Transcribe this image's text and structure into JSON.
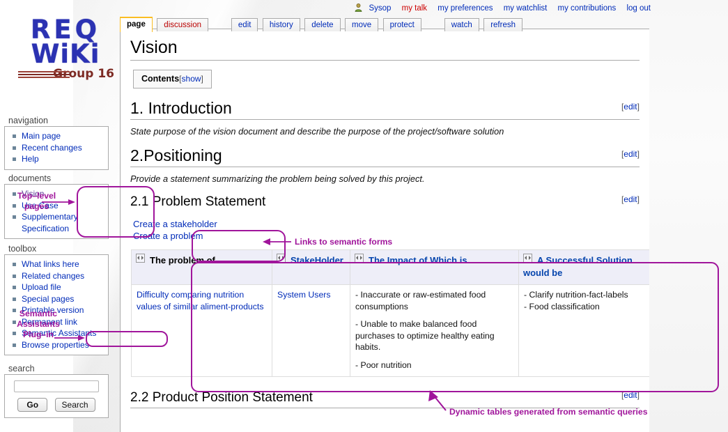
{
  "logo": {
    "line1": "REQ",
    "line2": "WiKi",
    "line3": "Group 16"
  },
  "personal": {
    "user": "Sysop",
    "links": [
      {
        "label": "my talk",
        "style": "new"
      },
      {
        "label": "my preferences",
        "style": "normal"
      },
      {
        "label": "my watchlist",
        "style": "normal"
      },
      {
        "label": "my contributions",
        "style": "normal"
      },
      {
        "label": "log out",
        "style": "normal"
      }
    ]
  },
  "tabs": [
    {
      "label": "page",
      "state": "selected"
    },
    {
      "label": "discussion",
      "state": "new"
    },
    {
      "label": "edit",
      "state": "normal"
    },
    {
      "label": "history",
      "state": "normal"
    },
    {
      "label": "delete",
      "state": "normal"
    },
    {
      "label": "move",
      "state": "normal"
    },
    {
      "label": "protect",
      "state": "normal"
    },
    {
      "label": "watch",
      "state": "normal"
    },
    {
      "label": "refresh",
      "state": "normal"
    }
  ],
  "sidebar": {
    "navigation": {
      "title": "navigation",
      "items": [
        {
          "label": "Main page",
          "visited": false
        },
        {
          "label": "Recent changes",
          "visited": false
        },
        {
          "label": "Help",
          "visited": false
        }
      ]
    },
    "documents": {
      "title": "documents",
      "items": [
        {
          "label": "Vision",
          "visited": true
        },
        {
          "label": "Use Case",
          "visited": false
        },
        {
          "label": "Supplementary",
          "visited": false,
          "cont": "Specification"
        }
      ]
    },
    "toolbox": {
      "title": "toolbox",
      "items": [
        {
          "label": "What links here"
        },
        {
          "label": "Related changes"
        },
        {
          "label": "Upload file"
        },
        {
          "label": "Special pages"
        },
        {
          "label": "Printable version"
        },
        {
          "label": "Permanent link"
        },
        {
          "label": "Semantic Assistants"
        },
        {
          "label": "Browse properties"
        }
      ]
    },
    "search": {
      "title": "search",
      "value": "",
      "placeholder": "",
      "go_label": "Go",
      "search_label": "Search"
    }
  },
  "page": {
    "title": "Vision",
    "toc": {
      "label": "Contents",
      "open_bracket": "[",
      "toggle": "show",
      "close_bracket": "]"
    },
    "sections": [
      {
        "heading": "1. Introduction",
        "edit": "edit",
        "lead": "State purpose of the vision document and describe the purpose of the project/software solution"
      },
      {
        "heading": "2.Positioning",
        "edit": "edit",
        "lead": "Provide a statement summarizing the problem being solved by this project."
      }
    ],
    "subsection_1": {
      "heading": "2.1 Problem Statement",
      "edit": "edit"
    },
    "subsection_2": {
      "heading": "2.2 Product Position Statement",
      "edit": "edit"
    },
    "form_links": [
      {
        "label": "Create a stakeholder"
      },
      {
        "label": "Create a problem"
      }
    ],
    "table": {
      "headers": [
        {
          "label": "The problem of",
          "color": "black"
        },
        {
          "label": "StakeHolder",
          "color": "blue"
        },
        {
          "label": "The Impact of Which is",
          "color": "blue"
        },
        {
          "label": "A Successful Solution would be",
          "color": "blue"
        }
      ],
      "rows": [
        {
          "problem": "Difficulty comparing nutrition values of similar aliment-products",
          "stakeholder": "System Users",
          "impacts": [
            "- Inaccurate or raw-estimated food consumptions",
            "- Unable to make balanced food purchases to optimize healthy eating habits.",
            "- Poor nutrition"
          ],
          "solutions": [
            "- Clarify nutrition-fact-labels",
            "- Food classification"
          ]
        }
      ]
    }
  },
  "annotations": {
    "top_level_pages": "Top–level\npages",
    "semantic_assistants_plugin": "Semantic\nAssistants\nPlug–in",
    "links_to_semantic_forms": "Links to semantic forms",
    "dynamic_tables": "Dynamic tables generated from semantic queries"
  },
  "colors": {
    "annotation": "#a0159b",
    "link": "#002bb8",
    "visited_link": "#5a3696",
    "new_link": "#cc0000",
    "tab_active_border": "#fabd23",
    "logo_blue": "#2b32b2",
    "logo_red": "#7d2b24",
    "table_header_bg": "#eeeef8"
  }
}
